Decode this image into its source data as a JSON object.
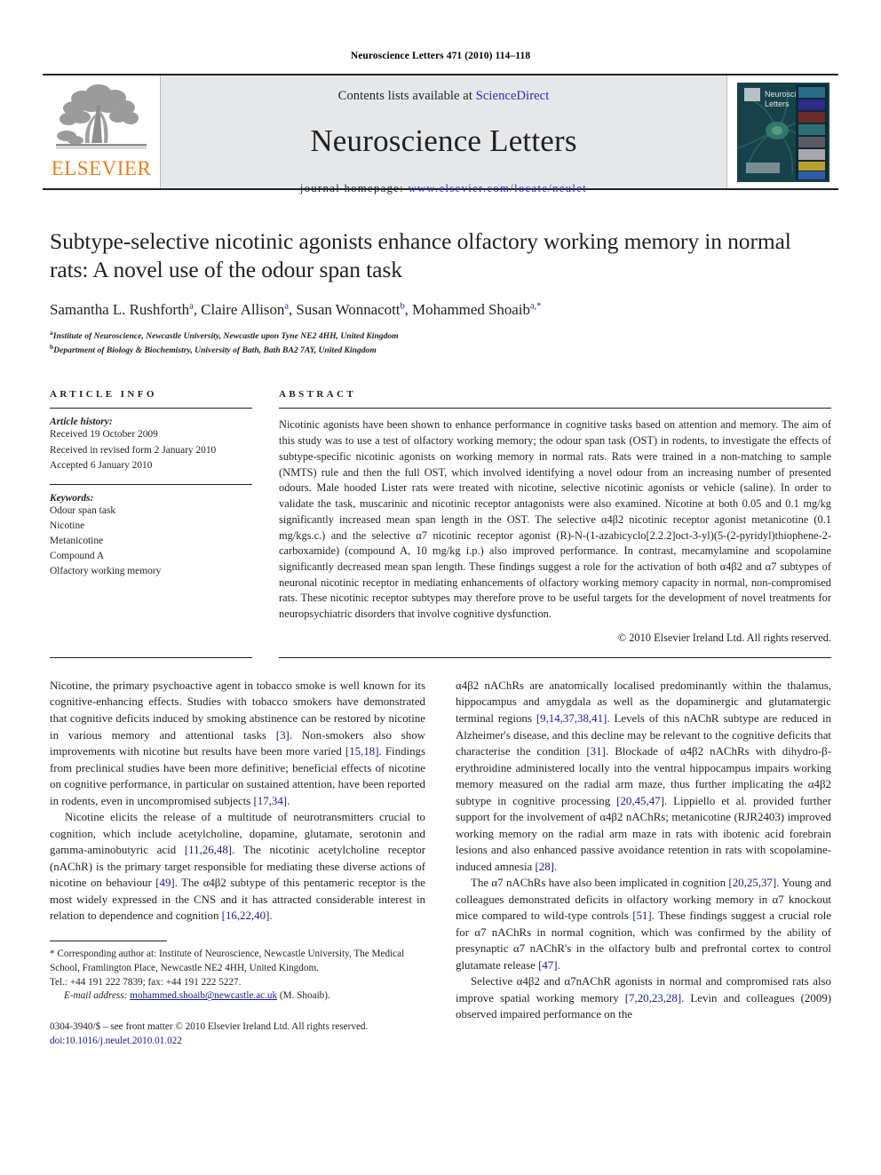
{
  "running_head": "Neuroscience Letters 471 (2010) 114–118",
  "masthead": {
    "publisher_name": "ELSEVIER",
    "contents_prefix": "Contents lists available at ",
    "contents_link": "ScienceDirect",
    "journal_name": "Neuroscience Letters",
    "homepage_prefix": "journal homepage: ",
    "homepage_url": "www.elsevier.com/locate/neulet",
    "cover_title_line1": "Neuroscience",
    "cover_title_line2": "Letters"
  },
  "article": {
    "title": "Subtype-selective nicotinic agonists enhance olfactory working memory in normal rats: A novel use of the odour span task",
    "authors": [
      {
        "name": "Samantha L. Rushforth",
        "sup": "a",
        "sep": ", "
      },
      {
        "name": "Claire Allison",
        "sup": "a",
        "sep": ", "
      },
      {
        "name": "Susan Wonnacott",
        "sup": "b",
        "sep": ", "
      },
      {
        "name": "Mohammed Shoaib",
        "sup": "a,*",
        "sep": ""
      }
    ],
    "affiliations": [
      {
        "label": "a",
        "text": "Institute of Neuroscience, Newcastle University, Newcastle upon Tyne NE2 4HH, United Kingdom"
      },
      {
        "label": "b",
        "text": "Department of Biology & Biochemistry, University of Bath, Bath BA2 7AY, United Kingdom"
      }
    ]
  },
  "article_info": {
    "heading": "ARTICLE INFO",
    "history_label": "Article history:",
    "history": [
      "Received 19 October 2009",
      "Received in revised form 2 January 2010",
      "Accepted 6 January 2010"
    ],
    "keywords_label": "Keywords:",
    "keywords": [
      "Odour span task",
      "Nicotine",
      "Metanicotine",
      "Compound A",
      "Olfactory working memory"
    ]
  },
  "abstract": {
    "heading": "ABSTRACT",
    "text": "Nicotinic agonists have been shown to enhance performance in cognitive tasks based on attention and memory. The aim of this study was to use a test of olfactory working memory; the odour span task (OST) in rodents, to investigate the effects of subtype-specific nicotinic agonists on working memory in normal rats. Rats were trained in a non-matching to sample (NMTS) rule and then the full OST, which involved identifying a novel odour from an increasing number of presented odours. Male hooded Lister rats were treated with nicotine, selective nicotinic agonists or vehicle (saline). In order to validate the task, muscarinic and nicotinic receptor antagonists were also examined. Nicotine at both 0.05 and 0.1 mg/kg significantly increased mean span length in the OST. The selective α4β2 nicotinic receptor agonist metanicotine (0.1 mg/kgs.c.) and the selective α7 nicotinic receptor agonist (R)-N-(1-azabicyclo[2.2.2]oct-3-yl)(5-(2-pyridyl)thiophene-2-carboxamide) (compound A, 10 mg/kg i.p.) also improved performance. In contrast, mecamylamine and scopolamine significantly decreased mean span length. These findings suggest a role for the activation of both α4β2 and α7 subtypes of neuronal nicotinic receptor in mediating enhancements of olfactory working memory capacity in normal, non-compromised rats. These nicotinic receptor subtypes may therefore prove to be useful targets for the development of novel treatments for neuropsychiatric disorders that involve cognitive dysfunction.",
    "copyright": "© 2010 Elsevier Ireland Ltd. All rights reserved."
  },
  "body": {
    "left_column": [
      {
        "segments": [
          {
            "t": "Nicotine, the primary psychoactive agent in tobacco smoke is well known for its cognitive-enhancing effects. Studies with tobacco smokers have demonstrated that cognitive deficits induced by smoking abstinence can be restored by nicotine in various memory and attentional tasks ",
            "ref": false
          },
          {
            "t": "[3]",
            "ref": true
          },
          {
            "t": ". Non-smokers also show improvements with nicotine but results have been more varied ",
            "ref": false
          },
          {
            "t": "[15,18]",
            "ref": true
          },
          {
            "t": ". Findings from preclinical studies have been more definitive; beneficial effects of nicotine on cognitive performance, in particular on sustained attention, have been reported in rodents, even in uncompromised subjects ",
            "ref": false
          },
          {
            "t": "[17,34]",
            "ref": true
          },
          {
            "t": ".",
            "ref": false
          }
        ]
      },
      {
        "segments": [
          {
            "t": "Nicotine elicits the release of a multitude of neurotransmitters crucial to cognition, which include acetylcholine, dopamine, glutamate, serotonin and gamma-aminobutyric acid ",
            "ref": false
          },
          {
            "t": "[11,26,48]",
            "ref": true
          },
          {
            "t": ". The nicotinic acetylcholine receptor (nAChR) is the primary target responsible for mediating these diverse actions of nicotine on behaviour ",
            "ref": false
          },
          {
            "t": "[49]",
            "ref": true
          },
          {
            "t": ". The α4β2 subtype of this pentameric receptor is the most widely expressed in the CNS and it has attracted considerable interest in relation to dependence and cognition ",
            "ref": false
          },
          {
            "t": "[16,22,40]",
            "ref": true
          },
          {
            "t": ".",
            "ref": false
          }
        ]
      }
    ],
    "right_column": [
      {
        "segments": [
          {
            "t": "α4β2 nAChRs are anatomically localised predominantly within the thalamus, hippocampus and amygdala as well as the dopaminergic and glutamatergic terminal regions ",
            "ref": false
          },
          {
            "t": "[9,14,37,38,41]",
            "ref": true
          },
          {
            "t": ". Levels of this nAChR subtype are reduced in Alzheimer's disease, and this decline may be relevant to the cognitive deficits that characterise the condition ",
            "ref": false
          },
          {
            "t": "[31]",
            "ref": true
          },
          {
            "t": ". Blockade of α4β2 nAChRs with dihydro-β-erythroidine administered locally into the ventral hippocampus impairs working memory measured on the radial arm maze, thus further implicating the α4β2 subtype in cognitive processing ",
            "ref": false
          },
          {
            "t": "[20,45,47]",
            "ref": true
          },
          {
            "t": ". Lippiello et al. provided further support for the involvement of α4β2 nAChRs; metanicotine (RJR2403) improved working memory on the radial arm maze in rats with ibotenic acid forebrain lesions and also enhanced passive avoidance retention in rats with scopolamine-induced amnesia ",
            "ref": false
          },
          {
            "t": "[28]",
            "ref": true
          },
          {
            "t": ".",
            "ref": false
          }
        ]
      },
      {
        "segments": [
          {
            "t": "The α7 nAChRs have also been implicated in cognition ",
            "ref": false
          },
          {
            "t": "[20,25,37]",
            "ref": true
          },
          {
            "t": ". Young and colleagues demonstrated deficits in olfactory working memory in α7 knockout mice compared to wild-type controls ",
            "ref": false
          },
          {
            "t": "[51]",
            "ref": true
          },
          {
            "t": ". These findings suggest a crucial role for α7 nAChRs in normal cognition, which was confirmed by the ability of presynaptic α7 nAChR's in the olfactory bulb and prefrontal cortex to control glutamate release ",
            "ref": false
          },
          {
            "t": "[47]",
            "ref": true
          },
          {
            "t": ".",
            "ref": false
          }
        ]
      },
      {
        "segments": [
          {
            "t": "Selective α4β2 and α7nAChR agonists in normal and compromised rats also improve spatial working memory ",
            "ref": false
          },
          {
            "t": "[7,20,23,28]",
            "ref": true
          },
          {
            "t": ". Levin and colleagues (2009) observed impaired performance on the",
            "ref": false
          }
        ]
      }
    ]
  },
  "footnote": {
    "star": "*",
    "corresponding": " Corresponding author at: Institute of Neuroscience, Newcastle University, The Medical School, Framlington Place, Newcastle NE2 4HH, United Kingdom.",
    "tel": "Tel.: +44 191 222 7839; fax: +44 191 222 5227.",
    "email_label": "E-mail address:",
    "email": "mohammed.shoaib@newcastle.ac.uk",
    "email_suffix": " (M. Shoaib)."
  },
  "footer": {
    "issn_line": "0304-3940/$ – see front matter © 2010 Elsevier Ireland Ltd. All rights reserved.",
    "doi": "doi:10.1016/j.neulet.2010.01.022"
  },
  "colors": {
    "link": "#2b2bbb",
    "reference": "#1a1a8c",
    "elsevier_orange": "#ef7d1a",
    "masthead_grey": "#e6e7e9",
    "cover_teal": "#17424a"
  }
}
